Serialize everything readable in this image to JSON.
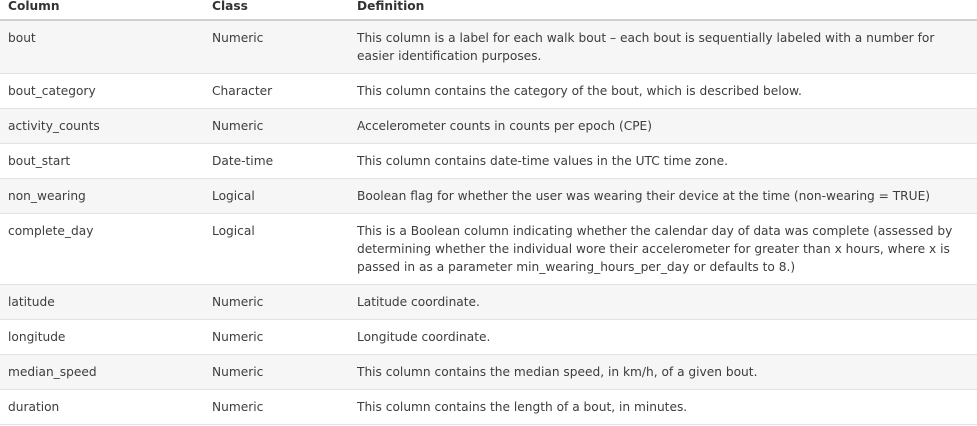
{
  "headers": {
    "column": "Column",
    "class": "Class",
    "definition": "Definition"
  },
  "rows": [
    {
      "column": "bout",
      "class": "Numeric",
      "definition": "This column is a label for each walk bout – each bout is sequentially labeled with a number for easier identification purposes."
    },
    {
      "column": "bout_category",
      "class": "Character",
      "definition": "This column contains the category of the bout, which is described below."
    },
    {
      "column": "activity_counts",
      "class": "Numeric",
      "definition": "Accelerometer counts in counts per epoch (CPE)"
    },
    {
      "column": "bout_start",
      "class": "Date-time",
      "definition": "This column contains date-time values in the UTC time zone."
    },
    {
      "column": "non_wearing",
      "class": "Logical",
      "definition": "Boolean flag for whether the user was wearing their device at the time (non-wearing = TRUE)"
    },
    {
      "column": "complete_day",
      "class": "Logical",
      "definition": "This is a Boolean column indicating whether the calendar day of data was complete (assessed by determining whether the individual wore their accelerometer for greater than x hours, where x is passed in as a parameter min_wearing_hours_per_day or defaults to 8.)"
    },
    {
      "column": "latitude",
      "class": "Numeric",
      "definition": "Latitude coordinate."
    },
    {
      "column": "longitude",
      "class": "Numeric",
      "definition": "Longitude coordinate."
    },
    {
      "column": "median_speed",
      "class": "Numeric",
      "definition": "This column contains the median speed, in km/h, of a given bout."
    },
    {
      "column": "duration",
      "class": "Numeric",
      "definition": "This column contains the length of a bout, in minutes."
    }
  ]
}
